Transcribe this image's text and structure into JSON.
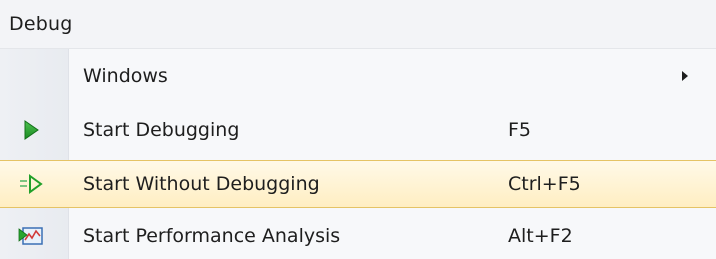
{
  "menu": {
    "title": "Debug",
    "items": [
      {
        "label": "Windows",
        "shortcut": "",
        "icon": "",
        "has_submenu": true
      },
      {
        "label": "Start Debugging",
        "shortcut": "F5",
        "icon": "play-icon"
      },
      {
        "label": "Start Without Debugging",
        "shortcut": "Ctrl+F5",
        "icon": "play-without-debugging-icon",
        "highlighted": true
      },
      {
        "label": "Start Performance Analysis",
        "shortcut": "Alt+F2",
        "icon": "performance-analysis-icon"
      }
    ]
  },
  "colors": {
    "highlight_background": "#ffeec2",
    "highlight_border": "#e5c365",
    "play_green": "#1f9d2b",
    "gutter": "#eef0f4"
  }
}
